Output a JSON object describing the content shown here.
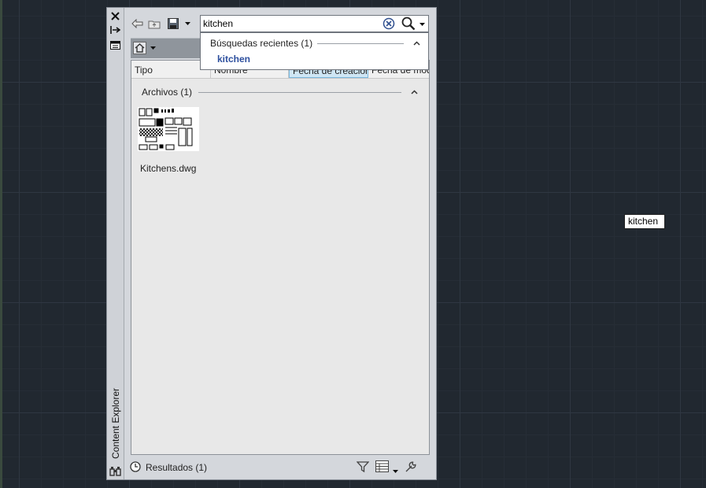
{
  "palette": {
    "title": "Content Explorer",
    "search": {
      "value": "kitchen"
    },
    "columns": [
      "Tipo",
      "Nombre",
      "Fecha de creación",
      "Fecha de mod"
    ],
    "active_column_index": 2,
    "group": {
      "label": "Archivos (1)"
    },
    "files": [
      {
        "name": "Kitchens.dwg"
      }
    ],
    "status": {
      "text": "Resultados (1)"
    },
    "recent_searches": {
      "label": "Búsquedas recientes (1)",
      "items": [
        "kitchen"
      ]
    }
  },
  "canvas": {
    "tooltip": "kitchen"
  },
  "colors": {
    "canvas_bg": "#212830",
    "accent": "#2d4f9e",
    "active_column": "#cfe6f4"
  }
}
